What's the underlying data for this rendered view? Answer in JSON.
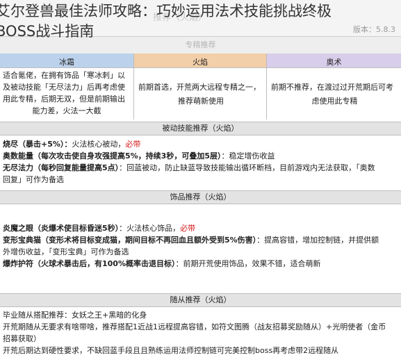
{
  "page": {
    "title_line1": "艾尔登兽最佳法师攻略：巧妙运用法术技能挑战终极",
    "title_line2": "BOSS战斗指南"
  },
  "header": {
    "ghost_title": "推荐（火焰）",
    "version": "版本：5.8.3",
    "rec_bar": "专精推荐"
  },
  "spec_table": {
    "columns": [
      {
        "name": "冰霜",
        "color": "#bcd2ec"
      },
      {
        "name": "火焰",
        "color": "#f2cfa8"
      },
      {
        "name": "奥术",
        "color": "#d8cdea"
      }
    ],
    "cells": [
      [
        "适合氪佬，在拥有饰品「寒冰刺」以",
        "及被动技能「无尽法力」后再考虑使",
        "用此专精，后期无双，但是前期输出",
        "能力差，火法一大截"
      ],
      [
        "前期首选，开荒两大远程专精之一，",
        "推荐萌新使用"
      ],
      [
        "前期不推荐，在渡过过开荒期后可考",
        "虑使用此专精"
      ]
    ]
  },
  "passive": {
    "heading": "被动技能推荐（火焰）",
    "lines": [
      {
        "bold": "烧尽（暴击+5%）：",
        "text": "火法核心被动，",
        "red": "必带"
      },
      {
        "bold": "奥数能量（每次攻击使自身攻强提高5%，持续3秒，可叠加5层）",
        "text": "：稳定增伤收益",
        "red": ""
      },
      {
        "bold": "无尽法力（每秒回复能量提高5点）",
        "text": "：回蓝被动，防止缺蓝导致技能输出循环断档，目前游戏内无法获取，「奥数",
        "red": ""
      },
      {
        "bold": "",
        "text": "回复」可作为备选",
        "red": ""
      }
    ]
  },
  "trinket": {
    "heading": "饰品推荐（火焰）",
    "lines": [
      {
        "bold": "炎魔之眼（炎爆术使目标昏迷5秒）",
        "text": "：火法核心饰品，",
        "red": "必带"
      },
      {
        "bold": "变形宝典猫（变形术将目标变成猫，期间目标不再回血且额外受到5%伤害）",
        "text": "：提高容错，增加控制链，并提供额",
        "red": ""
      },
      {
        "bold": "",
        "text": "外增伤收益，「变形宝典」可作为备选",
        "red": ""
      },
      {
        "bold": "爆炸护符（火球术暴击后，有100%概率击退目标）",
        "text": "：前期开荒使用饰品，效果不错，适合萌新",
        "red": ""
      }
    ]
  },
  "follower": {
    "heading": "随从推荐（火焰）",
    "lines": [
      "毕业随从搭配推荐：女妖之王+黑暗的化身",
      "开荒期随从无要求有啥带啥，推荐搭配1近战1远程提高容错，如符文图腾（战友招募奖励随从）+光明使者（金币",
      "招募获取）",
      "开荒后期达到硬性要求，不缺回蓝手段且且熟练运用法师控制链可完美控制boss再考虑带2远程随从"
    ]
  }
}
